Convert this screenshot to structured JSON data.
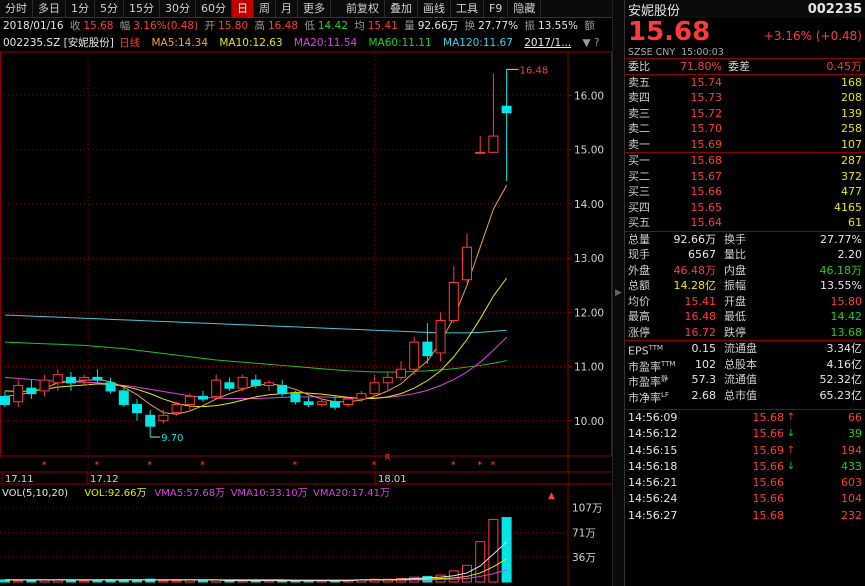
{
  "toolbar": {
    "items": [
      "分时",
      "多日",
      "1分",
      "5分",
      "15分",
      "30分",
      "60分",
      "日",
      "周",
      "月",
      "更多",
      "前复权",
      "叠加",
      "画线",
      "工具",
      "F9",
      "隐藏"
    ],
    "active_index": 7
  },
  "quote": {
    "date": "2018/01/16",
    "close_label": "收",
    "close": "15.68",
    "amp_label": "幅",
    "amp": "3.16%(0.48)",
    "open_label": "开",
    "open": "15.80",
    "high_label": "高",
    "high": "16.48",
    "low_label": "低",
    "low": "14.42",
    "avg_label": "均",
    "avg": "15.41",
    "vol_label": "量",
    "vol": "92.66万",
    "turnover_label": "换",
    "turnover": "27.77%",
    "swing_label": "振",
    "swing": "13.55%",
    "amount_label": "额"
  },
  "legend": {
    "code": "002235.SZ [安妮股份]",
    "period": "日线",
    "ma5": "MA5:14.34",
    "ma10": "MA10:12.63",
    "ma20": "MA20:11.54",
    "ma60": "MA60:11.11",
    "ma120": "MA120:11.67",
    "last": "2017/1..."
  },
  "colors": {
    "up": "#ff3a3a",
    "down": "#00e5e5",
    "ma5": "#f0a040",
    "ma10": "#e8e800",
    "ma20": "#e040e0",
    "ma60": "#20c020",
    "ma120": "#40c8d8",
    "grid": "#8b0000"
  },
  "chart_data": {
    "type": "candlestick",
    "y_ticks": [
      "16.00",
      "15.00",
      "14.00",
      "13.00",
      "12.00",
      "11.00",
      "10.00"
    ],
    "ylim": [
      9.35,
      16.8
    ],
    "x_labels": [
      "17.11",
      "17.12",
      "18.01"
    ],
    "high_marker": "16.48",
    "low_marker": "9.70",
    "r_marker": "R",
    "candles": [
      {
        "o": 10.45,
        "h": 10.55,
        "l": 10.25,
        "c": 10.3
      },
      {
        "o": 10.35,
        "h": 10.75,
        "l": 10.25,
        "c": 10.65
      },
      {
        "o": 10.6,
        "h": 10.75,
        "l": 10.4,
        "c": 10.5
      },
      {
        "o": 10.55,
        "h": 10.85,
        "l": 10.45,
        "c": 10.75
      },
      {
        "o": 10.7,
        "h": 10.95,
        "l": 10.55,
        "c": 10.85
      },
      {
        "o": 10.8,
        "h": 10.9,
        "l": 10.55,
        "c": 10.7
      },
      {
        "o": 10.75,
        "h": 10.85,
        "l": 10.65,
        "c": 10.8
      },
      {
        "o": 10.8,
        "h": 10.95,
        "l": 10.7,
        "c": 10.75
      },
      {
        "o": 10.7,
        "h": 10.8,
        "l": 10.5,
        "c": 10.55
      },
      {
        "o": 10.55,
        "h": 10.6,
        "l": 10.25,
        "c": 10.3
      },
      {
        "o": 10.3,
        "h": 10.4,
        "l": 10.0,
        "c": 10.15
      },
      {
        "o": 10.1,
        "h": 10.2,
        "l": 9.7,
        "c": 9.9
      },
      {
        "o": 10.0,
        "h": 10.2,
        "l": 9.95,
        "c": 10.1
      },
      {
        "o": 10.15,
        "h": 10.35,
        "l": 10.1,
        "c": 10.3
      },
      {
        "o": 10.3,
        "h": 10.5,
        "l": 10.2,
        "c": 10.45
      },
      {
        "o": 10.45,
        "h": 10.55,
        "l": 10.35,
        "c": 10.4
      },
      {
        "o": 10.45,
        "h": 10.85,
        "l": 10.4,
        "c": 10.75
      },
      {
        "o": 10.7,
        "h": 10.8,
        "l": 10.55,
        "c": 10.6
      },
      {
        "o": 10.6,
        "h": 10.85,
        "l": 10.55,
        "c": 10.8
      },
      {
        "o": 10.75,
        "h": 10.85,
        "l": 10.6,
        "c": 10.65
      },
      {
        "o": 10.65,
        "h": 10.75,
        "l": 10.55,
        "c": 10.7
      },
      {
        "o": 10.65,
        "h": 10.75,
        "l": 10.45,
        "c": 10.5
      },
      {
        "o": 10.5,
        "h": 10.55,
        "l": 10.3,
        "c": 10.35
      },
      {
        "o": 10.35,
        "h": 10.45,
        "l": 10.25,
        "c": 10.3
      },
      {
        "o": 10.3,
        "h": 10.4,
        "l": 10.25,
        "c": 10.35
      },
      {
        "o": 10.35,
        "h": 10.45,
        "l": 10.2,
        "c": 10.25
      },
      {
        "o": 10.3,
        "h": 10.45,
        "l": 10.25,
        "c": 10.4
      },
      {
        "o": 10.4,
        "h": 10.55,
        "l": 10.35,
        "c": 10.5
      },
      {
        "o": 10.5,
        "h": 10.85,
        "l": 10.45,
        "c": 10.7
      },
      {
        "o": 10.7,
        "h": 10.9,
        "l": 10.55,
        "c": 10.8
      },
      {
        "o": 10.8,
        "h": 11.1,
        "l": 10.75,
        "c": 10.95
      },
      {
        "o": 10.95,
        "h": 11.55,
        "l": 10.85,
        "c": 11.45
      },
      {
        "o": 11.45,
        "h": 11.8,
        "l": 11.05,
        "c": 11.2
      },
      {
        "o": 11.25,
        "h": 12.0,
        "l": 11.1,
        "c": 11.85
      },
      {
        "o": 11.85,
        "h": 12.85,
        "l": 11.8,
        "c": 12.55
      },
      {
        "o": 12.6,
        "h": 13.45,
        "l": 12.55,
        "c": 13.2
      },
      {
        "o": 14.95,
        "h": 15.25,
        "l": 14.95,
        "c": 14.95
      },
      {
        "o": 14.95,
        "h": 16.4,
        "l": 14.95,
        "c": 15.25
      },
      {
        "o": 15.8,
        "h": 16.48,
        "l": 14.42,
        "c": 15.68
      }
    ],
    "ma5": [
      10.45,
      10.48,
      10.52,
      10.6,
      10.7,
      10.72,
      10.74,
      10.76,
      10.72,
      10.62,
      10.48,
      10.3,
      10.15,
      10.12,
      10.18,
      10.28,
      10.4,
      10.5,
      10.58,
      10.65,
      10.68,
      10.65,
      10.58,
      10.48,
      10.4,
      10.35,
      10.35,
      10.38,
      10.45,
      10.55,
      10.68,
      10.9,
      11.1,
      11.45,
      11.9,
      12.5,
      13.2,
      13.9,
      14.34
    ],
    "ma10": [
      10.55,
      10.54,
      10.55,
      10.58,
      10.62,
      10.64,
      10.66,
      10.68,
      10.67,
      10.64,
      10.58,
      10.5,
      10.4,
      10.32,
      10.27,
      10.26,
      10.28,
      10.32,
      10.38,
      10.44,
      10.48,
      10.5,
      10.52,
      10.51,
      10.49,
      10.46,
      10.43,
      10.41,
      10.41,
      10.44,
      10.5,
      10.6,
      10.74,
      10.92,
      11.18,
      11.5,
      11.88,
      12.3,
      12.63
    ],
    "ma20": [
      10.8,
      10.78,
      10.76,
      10.74,
      10.73,
      10.72,
      10.71,
      10.7,
      10.68,
      10.65,
      10.62,
      10.58,
      10.54,
      10.5,
      10.46,
      10.43,
      10.42,
      10.41,
      10.41,
      10.41,
      10.42,
      10.43,
      10.44,
      10.44,
      10.44,
      10.43,
      10.42,
      10.42,
      10.42,
      10.43,
      10.46,
      10.5,
      10.56,
      10.65,
      10.76,
      10.9,
      11.08,
      11.3,
      11.54
    ],
    "ma60": [
      11.45,
      11.44,
      11.43,
      11.42,
      11.41,
      11.4,
      11.39,
      11.37,
      11.35,
      11.33,
      11.3,
      11.27,
      11.24,
      11.21,
      11.18,
      11.15,
      11.12,
      11.1,
      11.08,
      11.06,
      11.04,
      11.02,
      11.0,
      10.98,
      10.96,
      10.94,
      10.92,
      10.91,
      10.9,
      10.9,
      10.9,
      10.91,
      10.92,
      10.94,
      10.96,
      10.99,
      11.02,
      11.06,
      11.11
    ],
    "ma120": [
      11.95,
      11.94,
      11.93,
      11.92,
      11.91,
      11.9,
      11.89,
      11.88,
      11.87,
      11.86,
      11.85,
      11.84,
      11.83,
      11.82,
      11.81,
      11.8,
      11.79,
      11.78,
      11.77,
      11.76,
      11.75,
      11.74,
      11.73,
      11.72,
      11.71,
      11.7,
      11.69,
      11.68,
      11.67,
      11.66,
      11.65,
      11.64,
      11.63,
      11.62,
      11.62,
      11.62,
      11.63,
      11.65,
      11.67
    ],
    "volume": {
      "legend": [
        "VOL(5,10,20)",
        "VOL:92.66万",
        "VMA5:57.68万",
        "VMA10:33.10万",
        "VMA20:17.41万"
      ],
      "ticks": [
        "107万",
        "71万",
        "36万"
      ],
      "ylim": [
        0,
        115
      ],
      "values": [
        3,
        2,
        2,
        3,
        3,
        2,
        2,
        2,
        3,
        3,
        3,
        4,
        2,
        2,
        3,
        2,
        3,
        2,
        2,
        2,
        2,
        2,
        2,
        2,
        2,
        2,
        2,
        3,
        4,
        4,
        5,
        7,
        8,
        10,
        16,
        24,
        58,
        90,
        92.66
      ],
      "vma5": [
        3,
        3,
        3,
        3,
        3,
        3,
        3,
        3,
        3,
        3,
        3,
        3,
        3,
        3,
        3,
        3,
        3,
        2,
        2,
        2,
        2,
        2,
        2,
        2,
        2,
        2,
        2,
        3,
        3,
        3,
        4,
        5,
        6,
        7,
        9,
        13,
        23,
        40,
        57.68
      ],
      "vma10": [
        3,
        3,
        3,
        3,
        3,
        3,
        3,
        3,
        3,
        3,
        3,
        3,
        3,
        3,
        3,
        3,
        3,
        3,
        3,
        3,
        3,
        3,
        2,
        2,
        2,
        2,
        2,
        3,
        3,
        3,
        3,
        4,
        4,
        5,
        6,
        8,
        13,
        22,
        33.1
      ],
      "vma20": [
        3,
        3,
        3,
        3,
        3,
        3,
        3,
        3,
        3,
        3,
        3,
        3,
        3,
        3,
        3,
        3,
        3,
        3,
        3,
        3,
        3,
        3,
        3,
        3,
        3,
        3,
        3,
        3,
        3,
        3,
        3,
        3,
        3,
        4,
        4,
        5,
        8,
        12,
        17.41
      ]
    }
  },
  "panel": {
    "name": "安妮股份",
    "code": "002235",
    "price": "15.68",
    "change": "+3.16% (+0.48)",
    "market": "SZSE CNY",
    "time": "15:00:03",
    "weibi_label": "委比",
    "weibi": "71.80%",
    "weicha_label": "委差",
    "weicha": "0.45万",
    "asks": [
      {
        "label": "卖五",
        "price": "15.74",
        "vol": "168"
      },
      {
        "label": "卖四",
        "price": "15.73",
        "vol": "208"
      },
      {
        "label": "卖三",
        "price": "15.72",
        "vol": "139"
      },
      {
        "label": "卖二",
        "price": "15.70",
        "vol": "258"
      },
      {
        "label": "卖一",
        "price": "15.69",
        "vol": "107"
      }
    ],
    "bids": [
      {
        "label": "买一",
        "price": "15.68",
        "vol": "287"
      },
      {
        "label": "买二",
        "price": "15.67",
        "vol": "372"
      },
      {
        "label": "买三",
        "price": "15.66",
        "vol": "477"
      },
      {
        "label": "买四",
        "price": "15.65",
        "vol": "4165"
      },
      {
        "label": "买五",
        "price": "15.64",
        "vol": "61"
      }
    ],
    "stats": [
      {
        "k1": "总量",
        "v1": "92.66万",
        "c1": "white",
        "k2": "换手",
        "v2": "27.77%",
        "c2": "white"
      },
      {
        "k1": "现手",
        "v1": "6567",
        "c1": "white",
        "k2": "量比",
        "v2": "2.20",
        "c2": "white"
      },
      {
        "k1": "外盘",
        "v1": "46.48万",
        "c1": "red",
        "k2": "内盘",
        "v2": "46.18万",
        "c2": "green"
      },
      {
        "k1": "总额",
        "v1": "14.28亿",
        "c1": "yellow",
        "k2": "振幅",
        "v2": "13.55%",
        "c2": "white"
      },
      {
        "k1": "均价",
        "v1": "15.41",
        "c1": "red",
        "k2": "开盘",
        "v2": "15.80",
        "c2": "red"
      },
      {
        "k1": "最高",
        "v1": "16.48",
        "c1": "red",
        "k2": "最低",
        "v2": "14.42",
        "c2": "green"
      },
      {
        "k1": "涨停",
        "v1": "16.72",
        "c1": "red",
        "k2": "跌停",
        "v2": "13.68",
        "c2": "green"
      }
    ],
    "fin": [
      {
        "k1": "EPS",
        "s1": "TTM",
        "v1": "0.15",
        "k2": "流通盘",
        "v2": "3.34亿"
      },
      {
        "k1": "市盈率",
        "s1": "TTM",
        "v1": "102",
        "k2": "总股本",
        "v2": "4.16亿"
      },
      {
        "k1": "市盈率",
        "s1": "静",
        "v1": "57.3",
        "k2": "流通值",
        "v2": "52.32亿"
      },
      {
        "k1": "市净率",
        "s1": "LF",
        "v1": "2.68",
        "k2": "总市值",
        "v2": "65.23亿"
      }
    ],
    "ticks": [
      {
        "t": "14:56:09",
        "p": "15.68",
        "dir": "up",
        "v": "66",
        "vc": "red"
      },
      {
        "t": "14:56:12",
        "p": "15.66",
        "dir": "down",
        "v": "39",
        "vc": "green"
      },
      {
        "t": "14:56:15",
        "p": "15.69",
        "dir": "up",
        "v": "194",
        "vc": "red"
      },
      {
        "t": "14:56:18",
        "p": "15.66",
        "dir": "down",
        "v": "433",
        "vc": "green"
      },
      {
        "t": "14:56:21",
        "p": "15.66",
        "dir": "",
        "v": "603",
        "vc": "red"
      },
      {
        "t": "14:56:24",
        "p": "15.66",
        "dir": "",
        "v": "104",
        "vc": "red"
      },
      {
        "t": "14:56:27",
        "p": "15.68",
        "dir": "",
        "v": "232",
        "vc": "red"
      }
    ]
  }
}
